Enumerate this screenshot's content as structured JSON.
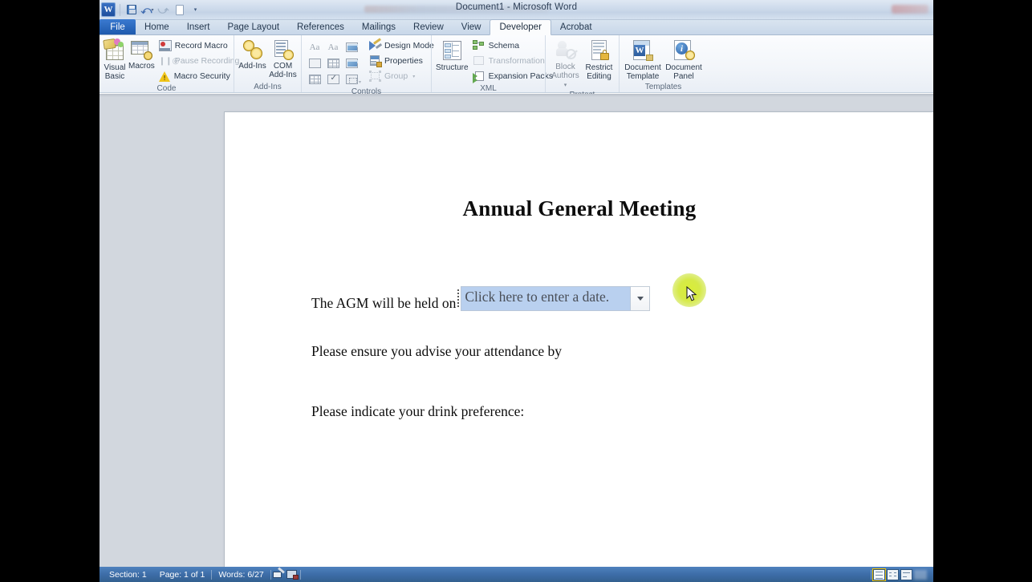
{
  "window": {
    "title": "Document1  -  Microsoft Word",
    "quick_access": [
      {
        "name": "word-logo",
        "label": "W"
      },
      {
        "name": "save-icon",
        "label": "Save"
      },
      {
        "name": "undo-icon",
        "label": "Undo"
      },
      {
        "name": "redo-icon",
        "label": "Redo"
      },
      {
        "name": "new-doc-icon",
        "label": "New"
      },
      {
        "name": "customize-qat-icon",
        "label": "Customize Quick Access Toolbar"
      }
    ]
  },
  "tabs": [
    {
      "label": "File",
      "kind": "file"
    },
    {
      "label": "Home",
      "kind": "normal"
    },
    {
      "label": "Insert",
      "kind": "normal"
    },
    {
      "label": "Page Layout",
      "kind": "normal"
    },
    {
      "label": "References",
      "kind": "normal"
    },
    {
      "label": "Mailings",
      "kind": "normal"
    },
    {
      "label": "Review",
      "kind": "normal"
    },
    {
      "label": "Developer",
      "kind": "active"
    },
    {
      "label": "Acrobat",
      "kind": "normal"
    }
  ],
  "ribbon": {
    "groups": [
      {
        "label": "Code",
        "big": [
          {
            "label_line1": "Visual",
            "label_line2": "Basic",
            "icon": "visual-basic-icon"
          },
          {
            "label_line1": "Macros",
            "label_line2": "",
            "icon": "macros-icon"
          }
        ],
        "small": [
          {
            "label": "Record Macro",
            "icon": "record-macro-icon",
            "disabled": false
          },
          {
            "label": "Pause Recording",
            "icon": "pause-recording-icon",
            "disabled": true
          },
          {
            "label": "Macro Security",
            "icon": "macro-security-icon",
            "disabled": false
          }
        ]
      },
      {
        "label": "Add-Ins",
        "big": [
          {
            "label_line1": "Add-Ins",
            "label_line2": "",
            "icon": "add-ins-icon"
          },
          {
            "label_line1": "COM",
            "label_line2": "Add-Ins",
            "icon": "com-add-ins-icon"
          }
        ],
        "small": []
      },
      {
        "label": "Controls",
        "grid": [
          {
            "name": "rich-text-content-control-icon"
          },
          {
            "name": "plain-text-content-control-icon"
          },
          {
            "name": "picture-content-control-icon"
          },
          {
            "name": "building-block-gallery-icon"
          },
          {
            "name": "combo-box-content-control-icon"
          },
          {
            "name": "drop-down-list-content-control-icon"
          },
          {
            "name": "date-picker-content-control-icon"
          },
          {
            "name": "check-box-content-control-icon"
          },
          {
            "name": "legacy-tools-icon"
          }
        ],
        "small": [
          {
            "label": "Design Mode",
            "icon": "design-mode-icon",
            "disabled": false
          },
          {
            "label": "Properties",
            "icon": "properties-icon",
            "disabled": false
          },
          {
            "label": "Group",
            "icon": "group-icon",
            "disabled": true
          }
        ]
      },
      {
        "label": "XML",
        "big": [
          {
            "label_line1": "Structure",
            "label_line2": "",
            "icon": "xml-structure-icon"
          }
        ],
        "small": [
          {
            "label": "Schema",
            "icon": "schema-icon",
            "disabled": false
          },
          {
            "label": "Transformation",
            "icon": "transformation-icon",
            "disabled": true
          },
          {
            "label": "Expansion Packs",
            "icon": "expansion-packs-icon",
            "disabled": false
          }
        ]
      },
      {
        "label": "Protect",
        "big": [
          {
            "label_line1": "Block",
            "label_line2": "Authors",
            "icon": "block-authors-icon",
            "disabled": true
          },
          {
            "label_line1": "Restrict",
            "label_line2": "Editing",
            "icon": "restrict-editing-icon"
          }
        ],
        "small": []
      },
      {
        "label": "Templates",
        "big": [
          {
            "label_line1": "Document",
            "label_line2": "Template",
            "icon": "document-template-icon"
          },
          {
            "label_line1": "Document",
            "label_line2": "Panel",
            "icon": "document-panel-icon"
          }
        ],
        "small": []
      }
    ]
  },
  "document": {
    "title": "Annual General Meeting",
    "line_agm_prefix": "The AGM will be held on",
    "date_picker_placeholder": "Click here to enter a date.",
    "line_attendance": "Please ensure you advise your attendance by",
    "line_drink": "Please indicate your drink preference:"
  },
  "statusbar": {
    "section": "Section: 1",
    "page": "Page: 1 of 1",
    "words": "Words: 6/27",
    "proofing_icon": "proofing-errors-icon",
    "language_icon": "language-icon",
    "view_buttons": [
      {
        "name": "print-layout-view-button",
        "selected": true
      },
      {
        "name": "full-screen-reading-view-button",
        "selected": false
      },
      {
        "name": "web-layout-view-button",
        "selected": false
      }
    ]
  },
  "colors": {
    "ribbon_accent": "#4f81bd",
    "file_tab": "#1e5aad",
    "selection_highlight": "#b9d0ef",
    "cursor_halo": "#d6ec24",
    "page_background": "#d2d7de"
  }
}
